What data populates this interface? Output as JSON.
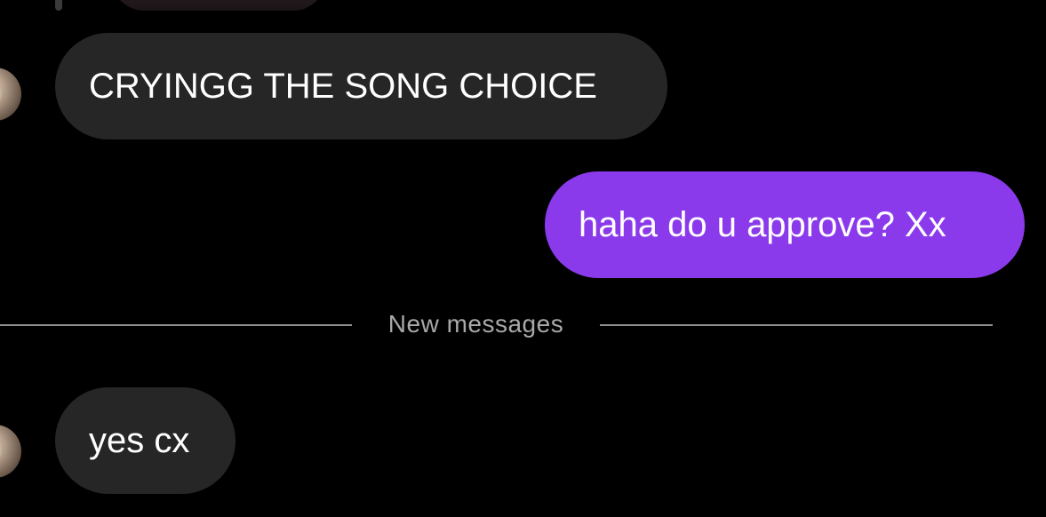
{
  "colors": {
    "background": "#000000",
    "incoming_bubble": "#262626",
    "outgoing_bubble": "#8B3AEB",
    "divider_line": "#8e8e8e",
    "divider_text": "#a8a8a8"
  },
  "messages": [
    {
      "direction": "incoming",
      "text": "CRYINGG THE SONG CHOICE"
    },
    {
      "direction": "outgoing",
      "text": "haha do u approve? Xx"
    },
    {
      "direction": "incoming",
      "text": "yes cx"
    }
  ],
  "divider": {
    "label": "New messages"
  }
}
